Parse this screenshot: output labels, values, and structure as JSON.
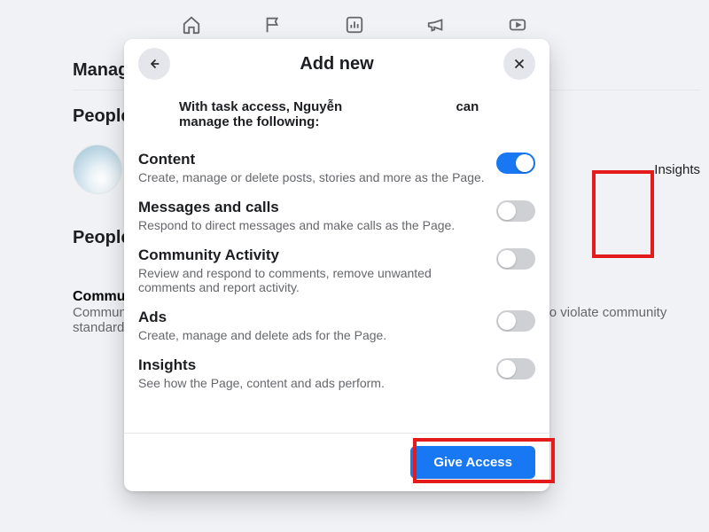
{
  "nav": {
    "icons": [
      "home",
      "flag",
      "insights",
      "megaphone",
      "video"
    ]
  },
  "bg": {
    "heading": "Manage",
    "section1": "People",
    "section2": "People",
    "tags_text": "Insights",
    "card_title": "Community",
    "card_body": "Community managers moderate chat discussions, suspend or remove people who violate community standards."
  },
  "modal": {
    "title": "Add new",
    "lead_prefix": "With task access, ",
    "lead_name": "Nguyễn",
    "lead_suffix": "can manage the following:",
    "rows": [
      {
        "head": "Content",
        "desc": "Create, manage or delete posts, stories and more as the Page.",
        "on": true
      },
      {
        "head": "Messages and calls",
        "desc": "Respond to direct messages and make calls as the Page.",
        "on": false
      },
      {
        "head": "Community Activity",
        "desc": "Review and respond to comments, remove unwanted comments and report activity.",
        "on": false
      },
      {
        "head": "Ads",
        "desc": "Create, manage and delete ads for the Page.",
        "on": false
      },
      {
        "head": "Insights",
        "desc": "See how the Page, content and ads perform.",
        "on": false
      }
    ],
    "cta": "Give Access"
  },
  "highlights": {
    "present": true
  }
}
